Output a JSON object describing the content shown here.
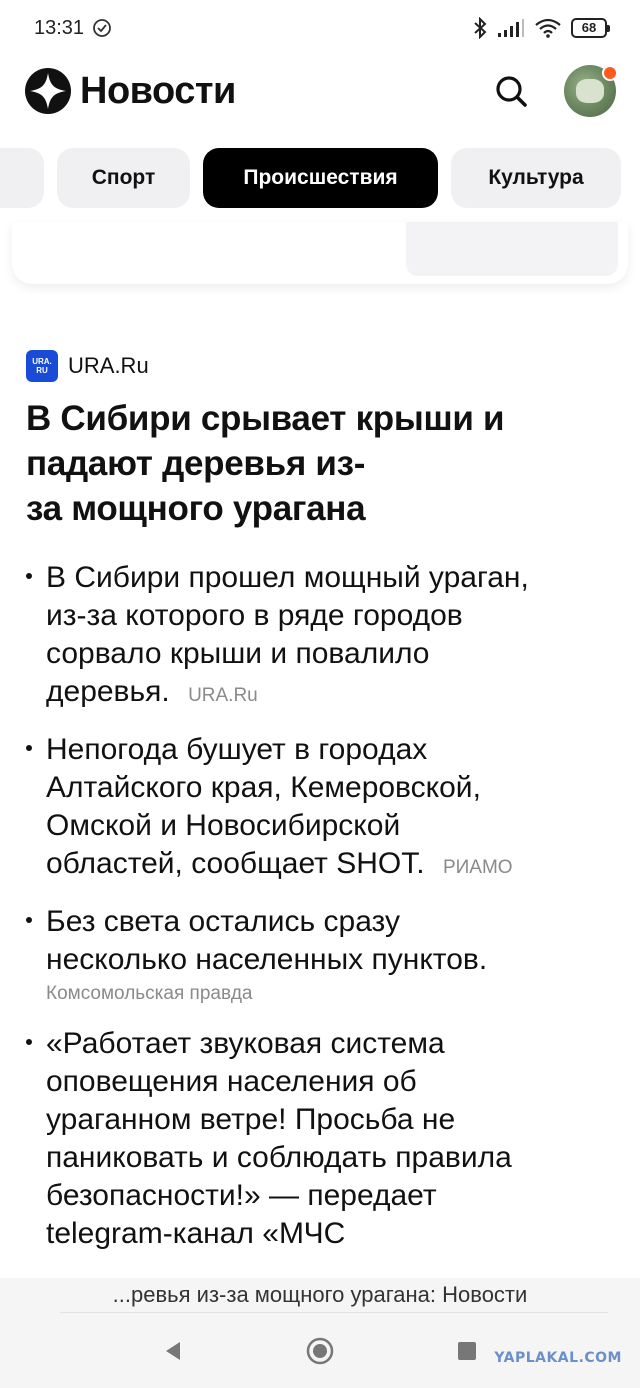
{
  "status_bar": {
    "time": "13:31",
    "battery": "68"
  },
  "header": {
    "title": "Новости"
  },
  "tabs": [
    {
      "label": "Спорт"
    },
    {
      "label": "Происшествия"
    },
    {
      "label": "Культура"
    }
  ],
  "article": {
    "source": "URA.Ru",
    "source_logo_text": "URA.\nRU",
    "headline_lines": [
      "В Сибири срывает крыши и",
      "падают деревья из-",
      "за мощного урагана"
    ],
    "bullets": [
      {
        "lines": [
          "В Сибири прошел мощный ураган,",
          "из-за которого в ряде городов",
          "сорвало крыши и повалило",
          "деревья."
        ],
        "source": "URA.Ru"
      },
      {
        "lines": [
          "Непогода бушует в городах",
          "Алтайского края, Кемеровской,",
          "Омской и Новосибирской",
          "областей, сообщает SHOT."
        ],
        "source": "РИАМО"
      },
      {
        "lines": [
          "Без света остались сразу",
          "несколько населенных пунктов."
        ],
        "source": "Комсомольская правда"
      },
      {
        "lines": [
          "«Работает звуковая система",
          "оповещения населения об",
          "ураганном ветре! Просьба не",
          "паниковать и соблюдать правила",
          "безопасности!» — передает",
          "telegram-канал «МЧС"
        ],
        "source": ""
      }
    ]
  },
  "bottom_bar": {
    "address": "...ревья из-за мощного урагана: Новости"
  },
  "watermark": "YAPLAKAL.COM"
}
